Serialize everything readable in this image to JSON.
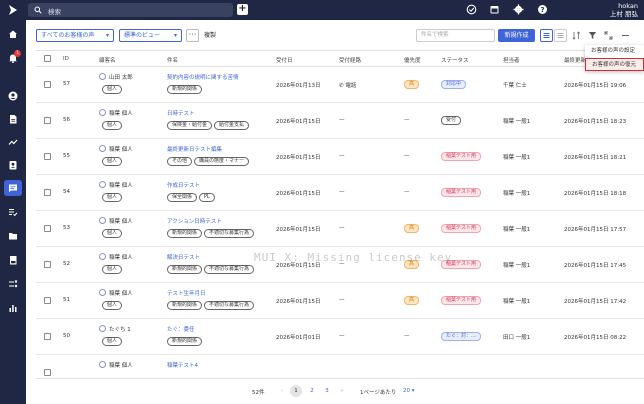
{
  "topbar": {
    "search_placeholder": "検索",
    "user_line1": "hokan",
    "user_line2": "上村 朋弘"
  },
  "sidebar": {
    "notification_count": "1"
  },
  "toolbar": {
    "filter_label": "すべてのお客様の声",
    "view_label": "標準のビュー",
    "more_label": "···",
    "copy_label": "複製",
    "search_placeholder": "件名で検索",
    "new_button": "新規作成"
  },
  "menu": {
    "items": [
      "お客様の声の設定",
      "お客様の声の復元"
    ]
  },
  "table": {
    "headers": [
      "ID",
      "顧客名",
      "件名",
      "受付日",
      "受付経路",
      "優先度",
      "ステータス",
      "担当者",
      "最終更新日"
    ],
    "rows": [
      {
        "id": "57",
        "customer": "山田 太郎",
        "kind": "個人",
        "subject": "契約内容の説明に関する苦情",
        "tags": [
          "新規的関係"
        ],
        "date": "2026年01月13日",
        "channel": "電話",
        "priority": "高",
        "status": "対応中",
        "status_style": "blue",
        "owner": "千葉 仁士",
        "updated": "2026年01月15日 19:06"
      },
      {
        "id": "56",
        "customer": "稲葉 個人",
        "kind": "個人",
        "subject": "日時テスト",
        "tags": [
          "保険金・給付金",
          "給付金支払"
        ],
        "date": "2026年01月15日",
        "channel": "—",
        "priority": "—",
        "status": "受付",
        "status_style": "grey",
        "owner": "稲葉 一般1",
        "updated": "2026年01月15日 18:23"
      },
      {
        "id": "55",
        "customer": "稲葉 個人",
        "kind": "個人",
        "subject": "最終更新日テスト編集",
        "tags": [
          "その他",
          "職員の態度・マナー"
        ],
        "date": "2026年01月15日",
        "channel": "—",
        "priority": "—",
        "status": "稲葉テスト用",
        "status_style": "pink",
        "owner": "稲葉 一般1",
        "updated": "2026年01月15日 18:21"
      },
      {
        "id": "54",
        "customer": "稲葉 個人",
        "kind": "個人",
        "subject": "作成日テスト",
        "tags": [
          "保全関係",
          "PL"
        ],
        "date": "2026年01月15日",
        "channel": "—",
        "priority": "—",
        "status": "稲葉テスト用",
        "status_style": "pink",
        "owner": "稲葉 一般1",
        "updated": "2026年01月15日 18:18"
      },
      {
        "id": "53",
        "customer": "稲葉 個人",
        "kind": "個人",
        "subject": "アクション日時テスト",
        "tags": [
          "新規的関係",
          "不適切な募集行為"
        ],
        "date": "2026年01月15日",
        "channel": "—",
        "priority": "高",
        "status": "稲葉テスト用",
        "status_style": "pink",
        "owner": "稲葉 一般1",
        "updated": "2026年01月15日 17:57"
      },
      {
        "id": "52",
        "customer": "稲葉 個人",
        "kind": "個人",
        "subject": "解決日テスト",
        "tags": [
          "新規的関係",
          "不適切な募集行為"
        ],
        "date": "2026年01月15日",
        "channel": "—",
        "priority": "高",
        "status": "稲葉テスト用",
        "status_style": "pink",
        "owner": "稲葉 一般1",
        "updated": "2026年01月15日 17:45"
      },
      {
        "id": "51",
        "customer": "稲葉 個人",
        "kind": "個人",
        "subject": "テスト生年月日",
        "tags": [
          "新規的関係",
          "不適切な募集行為"
        ],
        "date": "2026年01月15日",
        "channel": "—",
        "priority": "高",
        "status": "稲葉テスト用",
        "status_style": "pink",
        "owner": "稲葉 一般1",
        "updated": "2026年01月15日 17:42"
      },
      {
        "id": "50",
        "customer": "たぐち 1",
        "kind": "個人",
        "subject": "たぐ：委任",
        "tags": [
          "新規的関係"
        ],
        "date": "2026年01月01日",
        "channel": "—",
        "priority": "—",
        "status": "たぐ：対：...",
        "status_style": "blue",
        "owner": "田口 一般1",
        "updated": "2026年01月15日 08:22"
      },
      {
        "id": "",
        "customer": "稲葉 個人",
        "kind": "",
        "subject": "稲葉テスト4",
        "tags": [],
        "date": "",
        "channel": "",
        "priority": "",
        "status": "",
        "status_style": "",
        "owner": "",
        "updated": ""
      }
    ]
  },
  "watermark": "MUI X: Missing license key",
  "pager": {
    "total": "52件",
    "pages": [
      "1",
      "2",
      "3"
    ],
    "per_page_label": "1ページあたり",
    "per_page_value": "20"
  },
  "colors": {
    "nav": "#1f2744",
    "accent": "#3e64d8",
    "highlight_border": "#d32f2f"
  }
}
